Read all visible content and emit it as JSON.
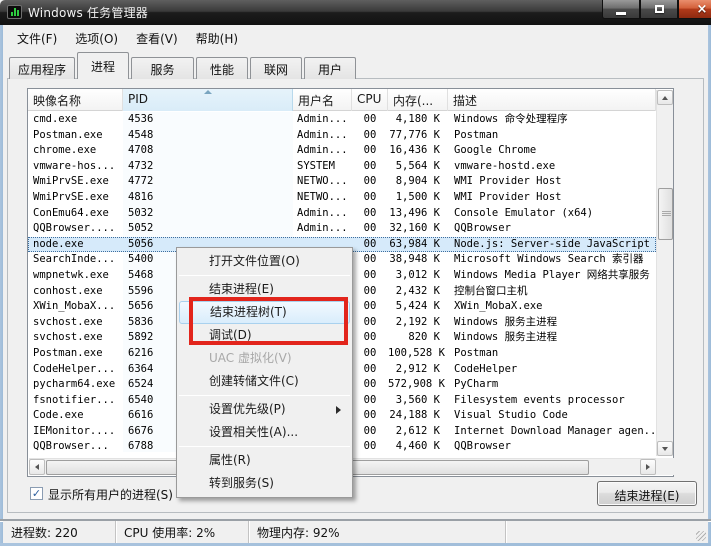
{
  "window": {
    "title": "Windows 任务管理器"
  },
  "icons": {
    "app": "taskmanager-icon",
    "minimize": "minimize-bar",
    "maximize": "maximize-square",
    "close": "×",
    "sort_ascending": "up-triangle",
    "submenu_arrow": "right-triangle",
    "checkbox_check": "✓"
  },
  "colors": {
    "annotation_red": "#e2251c",
    "selection_blue": "#d6eafa",
    "menu_hover_blue": "#d9edfc",
    "titlebar_dark": "#1c1c1c"
  },
  "menubar": {
    "items": [
      "文件(F)",
      "选项(O)",
      "查看(V)",
      "帮助(H)"
    ]
  },
  "tabs": [
    {
      "label": "应用程序",
      "active": false
    },
    {
      "label": "进程",
      "active": true
    },
    {
      "label": "服务",
      "active": false
    },
    {
      "label": "性能",
      "active": false
    },
    {
      "label": "联网",
      "active": false
    },
    {
      "label": "用户",
      "active": false
    }
  ],
  "table": {
    "columns": [
      {
        "label": "映像名称",
        "sorted": false
      },
      {
        "label": "PID",
        "sorted": true,
        "sort_direction": "asc"
      },
      {
        "label": "用户名",
        "sorted": false
      },
      {
        "label": "CPU",
        "sorted": false
      },
      {
        "label": "内存(...",
        "sorted": false
      },
      {
        "label": "描述",
        "sorted": false
      }
    ],
    "rows": [
      {
        "name": "cmd.exe",
        "pid": "4536",
        "user": "Admin...",
        "cpu": "00",
        "mem": "4,180 K",
        "desc": "Windows 命令处理程序",
        "selected": false
      },
      {
        "name": "Postman.exe",
        "pid": "4548",
        "user": "Admin...",
        "cpu": "00",
        "mem": "77,776 K",
        "desc": "Postman",
        "selected": false
      },
      {
        "name": "chrome.exe",
        "pid": "4708",
        "user": "Admin...",
        "cpu": "00",
        "mem": "16,436 K",
        "desc": "Google Chrome",
        "selected": false
      },
      {
        "name": "vmware-hos...",
        "pid": "4732",
        "user": "SYSTEM",
        "cpu": "00",
        "mem": "5,564 K",
        "desc": "vmware-hostd.exe",
        "selected": false
      },
      {
        "name": "WmiPrvSE.exe",
        "pid": "4772",
        "user": "NETWO...",
        "cpu": "00",
        "mem": "8,904 K",
        "desc": "WMI Provider Host",
        "selected": false
      },
      {
        "name": "WmiPrvSE.exe",
        "pid": "4816",
        "user": "NETWO...",
        "cpu": "00",
        "mem": "1,500 K",
        "desc": "WMI Provider Host",
        "selected": false
      },
      {
        "name": "ConEmu64.exe",
        "pid": "5032",
        "user": "Admin...",
        "cpu": "00",
        "mem": "13,496 K",
        "desc": "Console Emulator (x64)",
        "selected": false
      },
      {
        "name": "QQBrowser....",
        "pid": "5052",
        "user": "Admin...",
        "cpu": "00",
        "mem": "32,160 K",
        "desc": "QQBrowser",
        "selected": false
      },
      {
        "name": "node.exe",
        "pid": "5056",
        "user": "",
        "cpu": "00",
        "mem": "63,984 K",
        "desc": "Node.js: Server-side JavaScript",
        "selected": true
      },
      {
        "name": "SearchInde...",
        "pid": "5400",
        "user": "",
        "cpu": "00",
        "mem": "38,948 K",
        "desc": "Microsoft Windows Search 索引器",
        "selected": false
      },
      {
        "name": "wmpnetwk.exe",
        "pid": "5468",
        "user": "",
        "cpu": "00",
        "mem": "3,012 K",
        "desc": "Windows Media Player 网络共享服务",
        "selected": false
      },
      {
        "name": "conhost.exe",
        "pid": "5596",
        "user": "",
        "cpu": "00",
        "mem": "2,432 K",
        "desc": "控制台窗口主机",
        "selected": false
      },
      {
        "name": "XWin_MobaX...",
        "pid": "5656",
        "user": "",
        "cpu": "00",
        "mem": "5,424 K",
        "desc": "XWin_MobaX.exe",
        "selected": false
      },
      {
        "name": "svchost.exe",
        "pid": "5836",
        "user": "",
        "cpu": "00",
        "mem": "2,192 K",
        "desc": "Windows 服务主进程",
        "selected": false
      },
      {
        "name": "svchost.exe",
        "pid": "5892",
        "user": "",
        "cpu": "00",
        "mem": "820 K",
        "desc": "Windows 服务主进程",
        "selected": false
      },
      {
        "name": "Postman.exe",
        "pid": "6216",
        "user": "",
        "cpu": "00",
        "mem": "100,528 K",
        "desc": "Postman",
        "selected": false
      },
      {
        "name": "CodeHelper...",
        "pid": "6364",
        "user": "",
        "cpu": "00",
        "mem": "2,912 K",
        "desc": "CodeHelper",
        "selected": false
      },
      {
        "name": "pycharm64.exe",
        "pid": "6524",
        "user": "",
        "cpu": "00",
        "mem": "572,908 K",
        "desc": "PyCharm",
        "selected": false
      },
      {
        "name": "fsnotifier...",
        "pid": "6540",
        "user": "",
        "cpu": "00",
        "mem": "3,560 K",
        "desc": "Filesystem events processor",
        "selected": false
      },
      {
        "name": "Code.exe",
        "pid": "6616",
        "user": "",
        "cpu": "00",
        "mem": "24,188 K",
        "desc": "Visual Studio Code",
        "selected": false
      },
      {
        "name": "IEMonitor....",
        "pid": "6676",
        "user": "",
        "cpu": "00",
        "mem": "2,612 K",
        "desc": "Internet Download Manager agen...",
        "selected": false
      },
      {
        "name": "QQBrowser...",
        "pid": "6788",
        "user": "",
        "cpu": "00",
        "mem": "4,460 K",
        "desc": "QQBrowser",
        "selected": false
      }
    ]
  },
  "context_menu": {
    "items": [
      {
        "type": "item",
        "label": "打开文件位置(O)",
        "state": "normal"
      },
      {
        "type": "separator"
      },
      {
        "type": "item",
        "label": "结束进程(E)",
        "state": "normal"
      },
      {
        "type": "item",
        "label": "结束进程树(T)",
        "state": "hover"
      },
      {
        "type": "item",
        "label": "调试(D)",
        "state": "normal"
      },
      {
        "type": "item",
        "label": "UAC 虚拟化(V)",
        "state": "disabled"
      },
      {
        "type": "item",
        "label": "创建转储文件(C)",
        "state": "normal"
      },
      {
        "type": "separator"
      },
      {
        "type": "item",
        "label": "设置优先级(P)",
        "state": "normal",
        "submenu": true
      },
      {
        "type": "item",
        "label": "设置相关性(A)...",
        "state": "normal"
      },
      {
        "type": "separator"
      },
      {
        "type": "item",
        "label": "属性(R)",
        "state": "normal"
      },
      {
        "type": "item",
        "label": "转到服务(S)",
        "state": "normal"
      }
    ]
  },
  "annotation": {
    "color": "#e2251c"
  },
  "footer": {
    "show_all_label": "显示所有用户的进程(S)",
    "show_all_checked": true,
    "end_process_button": "结束进程(E)"
  },
  "statusbar": {
    "cells": [
      "进程数: 220",
      "CPU 使用率: 2%",
      "物理内存: 92%"
    ]
  }
}
